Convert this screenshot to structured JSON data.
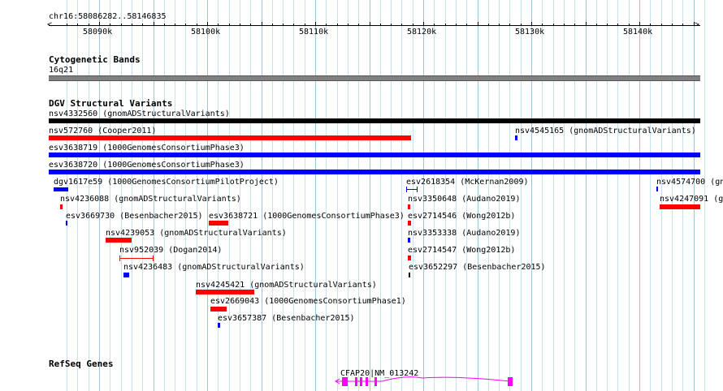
{
  "position_label": "chr16:58086282..58146835",
  "scale": {
    "ticks": [
      {
        "label": "58090k",
        "pos": 58090000
      },
      {
        "label": "58100k",
        "pos": 58100000
      },
      {
        "label": "58110k",
        "pos": 58110000
      },
      {
        "label": "58120k",
        "pos": 58120000
      },
      {
        "label": "58130k",
        "pos": 58130000
      },
      {
        "label": "58140k",
        "pos": 58140000
      }
    ]
  },
  "tracks": {
    "cytoband": {
      "title": "Cytogenetic Bands",
      "band": "16q21"
    },
    "dgv": {
      "title": "DGV Structural Variants"
    },
    "refseq": {
      "title": "RefSeq Genes",
      "gene_label": "CFAP20|NM_013242"
    }
  },
  "colors": {
    "loss": "#ff0000",
    "gain": "#0000ff",
    "complex": "#000000",
    "gene": "#ff00ff",
    "grid": "#add8e6",
    "band": "#808080"
  },
  "features": [
    {
      "label": "nsv4332560 (gnomADStructuralVariants)",
      "color": "complex"
    },
    {
      "label": "nsv572760 (Cooper2011)",
      "color": "loss"
    },
    {
      "label": "nsv4545165 (gnomADStructuralVariants)",
      "color": "gain"
    },
    {
      "label": "esv3638719 (1000GenomesConsortiumPhase3)",
      "color": "gain"
    },
    {
      "label": "esv3638720 (1000GenomesConsortiumPhase3)",
      "color": "gain"
    },
    {
      "label": "dgv1617e59 (1000GenomesConsortiumPilotProject)",
      "color": "gain"
    },
    {
      "label": "esv2618354 (McKernan2009)",
      "color": "gain"
    },
    {
      "label": "nsv4574700 (gn",
      "color": "gain"
    },
    {
      "label": "nsv4236088 (gnomADStructuralVariants)",
      "color": "loss"
    },
    {
      "label": "nsv3350648 (Audano2019)",
      "color": "loss"
    },
    {
      "label": "nsv4247091 (gn",
      "color": "loss"
    },
    {
      "label": "esv3669730 (Besenbacher2015)",
      "color": "gain"
    },
    {
      "label": "esv3638721 (1000GenomesConsortiumPhase3)",
      "color": "loss"
    },
    {
      "label": "esv2714546 (Wong2012b)",
      "color": "loss"
    },
    {
      "label": "nsv4239053 (gnomADStructuralVariants)",
      "color": "loss"
    },
    {
      "label": "nsv3353338 (Audano2019)",
      "color": "gain"
    },
    {
      "label": "nsv952039 (Dogan2014)",
      "color": "loss"
    },
    {
      "label": "esv2714547 (Wong2012b)",
      "color": "loss"
    },
    {
      "label": "nsv4236483 (gnomADStructuralVariants)",
      "color": "gain"
    },
    {
      "label": "esv3652297 (Besenbacher2015)",
      "color": "complex"
    },
    {
      "label": "nsv4245421 (gnomADStructuralVariants)",
      "color": "loss"
    },
    {
      "label": "esv2669043 (1000GenomesConsortiumPhase1)",
      "color": "loss"
    },
    {
      "label": "esv3657387 (Besenbacher2015)",
      "color": "gain"
    }
  ]
}
